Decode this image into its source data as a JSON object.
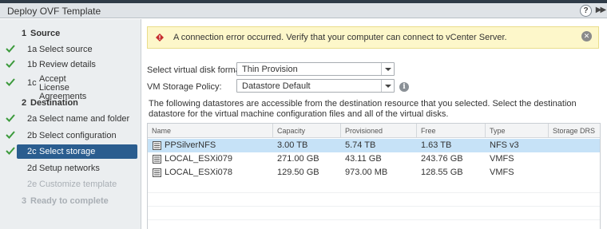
{
  "window": {
    "title": "Deploy OVF Template",
    "help_label": "?",
    "expand_label": "▶▶"
  },
  "steps": [
    {
      "num": "1",
      "label": "Source",
      "kind": "section",
      "checked": false
    },
    {
      "num": "1a",
      "label": "Select source",
      "kind": "sub",
      "checked": true
    },
    {
      "num": "1b",
      "label": "Review details",
      "kind": "sub",
      "checked": true
    },
    {
      "num": "1c",
      "label": "Accept License Agreements",
      "kind": "sub",
      "checked": true
    },
    {
      "num": "2",
      "label": "Destination",
      "kind": "section",
      "checked": false
    },
    {
      "num": "2a",
      "label": "Select name and folder",
      "kind": "sub",
      "checked": true
    },
    {
      "num": "2b",
      "label": "Select configuration",
      "kind": "sub",
      "checked": true
    },
    {
      "num": "2c",
      "label": "Select storage",
      "kind": "sub",
      "checked": true,
      "active": true
    },
    {
      "num": "2d",
      "label": "Setup networks",
      "kind": "sub",
      "checked": false
    },
    {
      "num": "2e",
      "label": "Customize template",
      "kind": "sub",
      "checked": false,
      "disabled": true
    },
    {
      "num": "3",
      "label": "Ready to complete",
      "kind": "section",
      "checked": false,
      "disabled": true
    }
  ],
  "alert": {
    "message": "A connection error occurred. Verify that your computer can connect to vCenter Server.",
    "close_label": "✕"
  },
  "form": {
    "disk_format_label": "Select virtual disk format:",
    "disk_format_value": "Thin Provision",
    "storage_policy_label": "VM Storage Policy:",
    "storage_policy_value": "Datastore Default",
    "info_label": "i"
  },
  "description": "The following datastores are accessible from the destination resource that you selected. Select the destination datastore for the virtual machine configuration files and all of the virtual disks.",
  "table": {
    "columns": [
      "Name",
      "Capacity",
      "Provisioned",
      "Free",
      "Type",
      "Storage DRS"
    ],
    "rows": [
      {
        "name": "PPSilverNFS",
        "capacity": "3.00 TB",
        "provisioned": "5.74 TB",
        "free": "1.63 TB",
        "type": "NFS v3",
        "drs": "",
        "selected": true
      },
      {
        "name": "LOCAL_ESXi079",
        "capacity": "271.00 GB",
        "provisioned": "43.11 GB",
        "free": "243.76 GB",
        "type": "VMFS",
        "drs": "",
        "selected": false
      },
      {
        "name": "LOCAL_ESXi078",
        "capacity": "129.50 GB",
        "provisioned": "973.00 MB",
        "free": "128.55 GB",
        "type": "VMFS",
        "drs": "",
        "selected": false
      }
    ]
  },
  "colors": {
    "accent": "#2a5d8f",
    "check_green": "#3c9a3c",
    "alert_bg": "#fdf7ca",
    "selected_row": "#c6e2f7"
  },
  "icons": {
    "check": "check-icon",
    "warning": "warning-icon",
    "close": "close-icon",
    "info": "info-icon",
    "datastore": "datastore-icon"
  }
}
